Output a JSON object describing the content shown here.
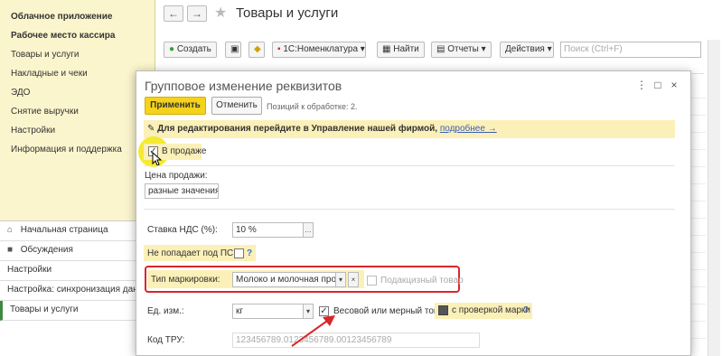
{
  "sidebar": {
    "sections": [
      {
        "label": "Облачное приложение",
        "bold": true
      },
      {
        "label": "Рабочее место кассира",
        "bold": true
      },
      {
        "label": "Товары и услуги",
        "bold": false
      },
      {
        "label": "Накладные и чеки",
        "bold": false
      },
      {
        "label": "ЭДО",
        "bold": false
      },
      {
        "label": "Снятие выручки",
        "bold": false
      },
      {
        "label": "Настройки",
        "bold": false
      },
      {
        "label": "Информация и поддержка",
        "bold": false
      }
    ],
    "bottom": {
      "home": "Начальная страница",
      "discussions": "Обсуждения",
      "settings": "Настройки",
      "sync": "Настройка: синхронизация данных",
      "products": "Товары и услуги"
    }
  },
  "main": {
    "title": "Товары и услуги",
    "back_icon": "←",
    "forward_icon": "→",
    "star_icon": "★",
    "toolbar": {
      "create": "Создать",
      "nomenclature": "1С:Номенклатура",
      "find": "Найти",
      "reports": "Отчеты",
      "actions": "Действия"
    },
    "search_placeholder": "Поиск (Ctrl+F)"
  },
  "dialog": {
    "title": "Групповое изменение реквизитов",
    "apply": "Применить",
    "cancel": "Отменить",
    "positions_note": "Позиций к обработке: 2.",
    "warning_text": "Для редактирования перейдите в Управление нашей фирмой,",
    "warning_link": "подробнее →",
    "on_sale": "В продаже",
    "on_sale_checked": true,
    "price_label": "Цена продажи:",
    "price_value": "разные значения",
    "vat_label": "Ставка НДС (%):",
    "vat_value": "10 %",
    "psn_label": "Не попадает под ПСН:",
    "psn_help": "?",
    "marking_label": "Тип маркировки:",
    "marking_value": "Молоко и молочная продук",
    "excise_label": "Подакцизный товар",
    "unit_label": "Ед. изм.:",
    "unit_value": "кг",
    "weight_label": "Весовой или мерный товар",
    "weight_checked": true,
    "mark_check_label": "с проверкой марки",
    "mark_check_help": "?",
    "tru_label": "Код ТРУ:",
    "tru_value": "123456789.0123456789.00123456789"
  },
  "colors": {
    "accent_yellow": "#f5d21b",
    "highlight_red": "#d9262a",
    "sidebar_bg": "#fbf5cd",
    "cursor_highlight": "#f3e81c"
  }
}
